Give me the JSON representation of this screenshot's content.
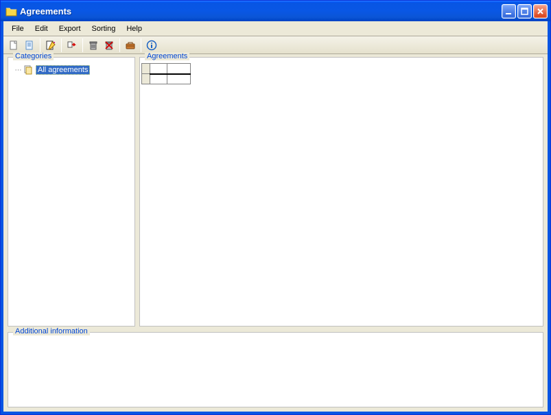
{
  "window": {
    "title": "Agreements"
  },
  "menu": {
    "file": "File",
    "edit": "Edit",
    "export": "Export",
    "sorting": "Sorting",
    "help": "Help"
  },
  "toolbar_icons": {
    "new_doc": "new-document-icon",
    "doc": "document-icon",
    "edit_doc": "edit-document-icon",
    "move": "move-icon",
    "delete": "delete-icon",
    "delete_all": "delete-all-icon",
    "briefcase": "briefcase-icon",
    "info": "info-icon"
  },
  "groups": {
    "categories": "Categories",
    "agreements": "Agreements",
    "additional": "Additional information"
  },
  "tree": {
    "root_label": "All agreements"
  }
}
